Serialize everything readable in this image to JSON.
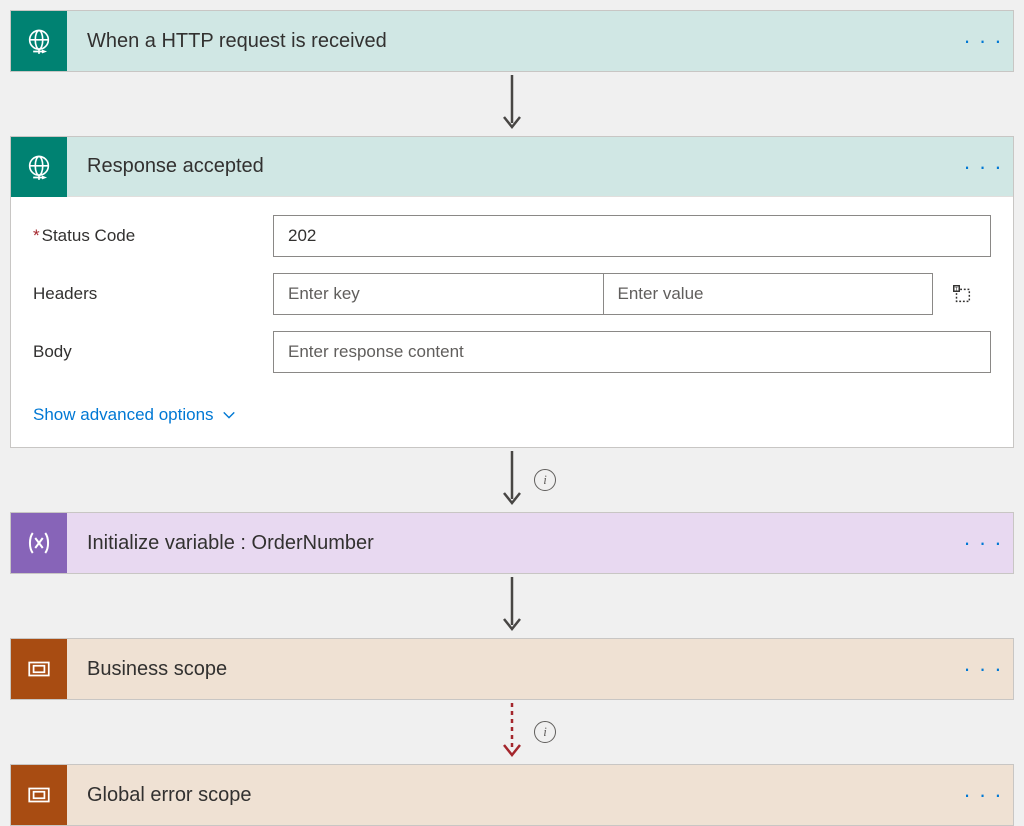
{
  "steps": {
    "trigger": {
      "title": "When a HTTP request is received"
    },
    "response": {
      "title": "Response accepted",
      "status_code_label": "Status Code",
      "status_code_value": "202",
      "headers_label": "Headers",
      "header_key_placeholder": "Enter key",
      "header_value_placeholder": "Enter value",
      "body_label": "Body",
      "body_placeholder": "Enter response content",
      "advanced_label": "Show advanced options"
    },
    "init_var": {
      "title": "Initialize variable : OrderNumber"
    },
    "business_scope": {
      "title": "Business scope"
    },
    "error_scope": {
      "title": "Global error scope"
    }
  },
  "menu_dots": "· · ·"
}
